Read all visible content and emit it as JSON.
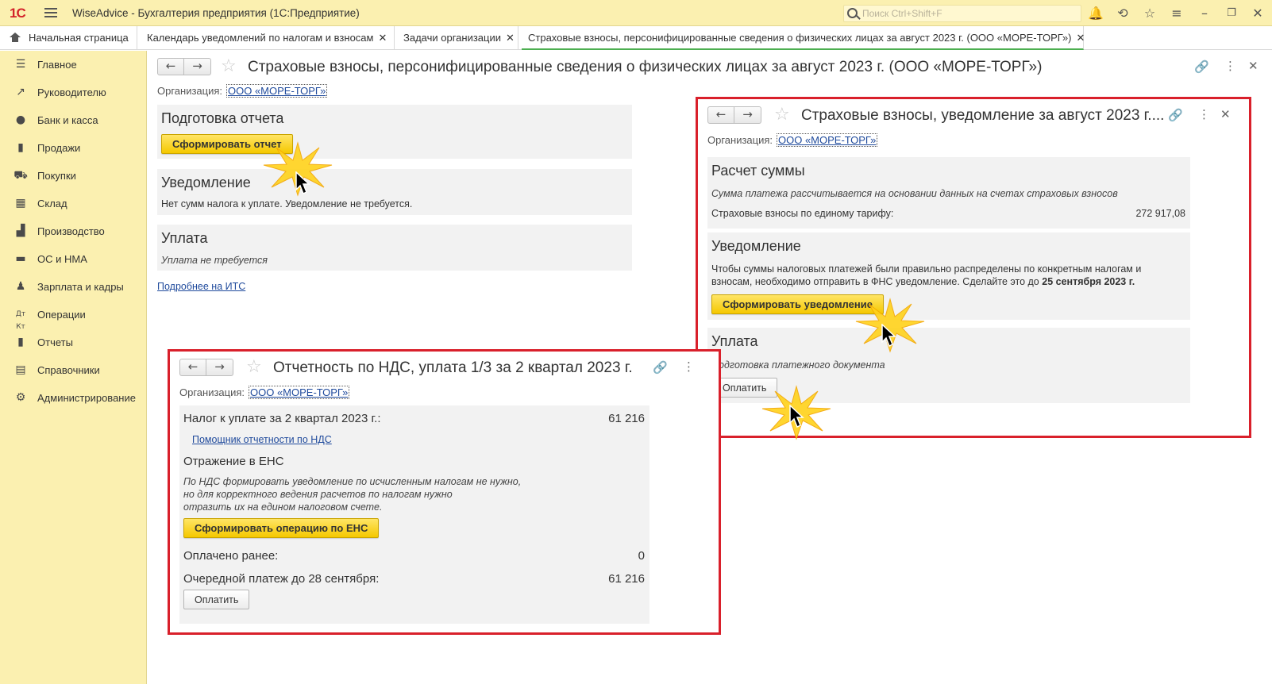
{
  "titlebar": {
    "logo": "1С",
    "app_title": "WiseAdvice - Бухгалтерия предприятия  (1С:Предприятие)",
    "search_placeholder": "Поиск Ctrl+Shift+F"
  },
  "tabs": [
    {
      "label": "Начальная страница"
    },
    {
      "label": "Календарь уведомлений по налогам и взносам"
    },
    {
      "label": "Задачи организации"
    },
    {
      "label": "Страховые взносы, персонифицированные сведения о физических лицах за август 2023 г. (ООО «МОРЕ-ТОРГ»)"
    }
  ],
  "sidebar": {
    "items": [
      {
        "label": "Главное",
        "icon": "menu-icon"
      },
      {
        "label": "Руководителю",
        "icon": "chart-trend-icon"
      },
      {
        "label": "Банк и касса",
        "icon": "coins-icon"
      },
      {
        "label": "Продажи",
        "icon": "bag-icon"
      },
      {
        "label": "Покупки",
        "icon": "cart-icon"
      },
      {
        "label": "Склад",
        "icon": "warehouse-icon"
      },
      {
        "label": "Производство",
        "icon": "factory-icon"
      },
      {
        "label": "ОС и НМА",
        "icon": "truck-icon"
      },
      {
        "label": "Зарплата и кадры",
        "icon": "person-icon"
      },
      {
        "label": "Операции",
        "icon": "dt-kt-icon"
      },
      {
        "label": "Отчеты",
        "icon": "bar-chart-icon"
      },
      {
        "label": "Справочники",
        "icon": "book-icon"
      },
      {
        "label": "Администрирование",
        "icon": "gear-icon"
      }
    ]
  },
  "main_form": {
    "title": "Страховые взносы, персонифицированные сведения о физических лицах за август 2023 г. (ООО «МОРЕ-ТОРГ»)",
    "org_label": "Организация:",
    "org_value": "ООО «МОРЕ-ТОРГ»",
    "prepare_title": "Подготовка отчета",
    "prepare_button": "Сформировать отчет",
    "notice_title": "Уведомление",
    "notice_text": "Нет сумм налога к уплате. Уведомление не требуется.",
    "payment_title": "Уплата",
    "payment_text": "Уплата не требуется",
    "more_link": "Подробнее на ИТС"
  },
  "popup_insurance": {
    "title": "Страховые взносы, уведомление за август 2023 г....",
    "org_label": "Организация:",
    "org_value": "ООО «МОРЕ-ТОРГ»",
    "calc_title": "Расчет суммы",
    "calc_text": "Сумма платежа рассчитывается на основании данных на счетах страховых взносов",
    "unified_label": "Страховые взносы по единому тарифу:",
    "unified_value": "272 917,08",
    "notice_title": "Уведомление",
    "notice_text_1": "Чтобы суммы налоговых платежей были правильно распределены по конкретным налогам и",
    "notice_text_2": "взносам, необходимо отправить в ФНС уведомление. Сделайте это до",
    "notice_date": "25 сентября 2023 г.",
    "notice_button": "Сформировать уведомление",
    "payment_title": "Уплата",
    "payment_text": "Подготовка платежного документа",
    "pay_button": "Оплатить"
  },
  "popup_vat": {
    "title": "Отчетность по НДС, уплата 1/3 за 2 квартал 2023 г.",
    "org_label": "Организация:",
    "org_value": "ООО «МОРЕ-ТОРГ»",
    "tax_label": "Налог к уплате за 2 квартал 2023 г.:",
    "tax_value": "61 216",
    "helper_link": "Помощник отчетности по НДС",
    "ens_title": "Отражение в ЕНС",
    "ens_text_1": "По НДС формировать уведомление по исчисленным налогам не нужно,",
    "ens_text_2": "но для корректного ведения расчетов по налогам нужно",
    "ens_text_3": "отразить их на едином налоговом счете.",
    "ens_button": "Сформировать операцию по ЕНС",
    "paid_label": "Оплачено ранее:",
    "paid_value": "0",
    "next_label": "Очередной платеж до 28 сентября:",
    "next_value": "61 216",
    "pay_button": "Оплатить"
  },
  "colors": {
    "sidebar_bg": "#fbf0b0",
    "accent_button": "#f5c800",
    "highlight_frame": "#d9202b",
    "link": "#1f4a9c"
  }
}
